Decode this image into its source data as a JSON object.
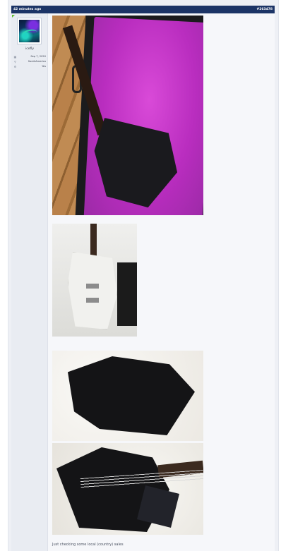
{
  "post": {
    "timestamp": "42 minutes ago",
    "post_number": "#263478",
    "author": {
      "username": "icefly",
      "avatar_icon": "avatar-image",
      "meta": [
        {
          "icon": "calendar-icon",
          "glyph": "▦",
          "value": "Sep 7, 2020"
        },
        {
          "icon": "location-icon",
          "glyph": "⚲",
          "value": "SouthAmerica"
        },
        {
          "icon": "settings-icon",
          "glyph": "⚙",
          "value": "Yes"
        }
      ]
    },
    "images": [
      {
        "name": "black bass in pink case photo"
      },
      {
        "name": "white bass on stand photo"
      },
      {
        "name": "black bass body back photo"
      },
      {
        "name": "black bass body front photo"
      }
    ],
    "text": "Just checking some local (country) sales"
  },
  "colors": {
    "header_bg": "#1c3466",
    "online_indicator": "#5fbf2b",
    "post_bg": "#f6f7fa"
  }
}
